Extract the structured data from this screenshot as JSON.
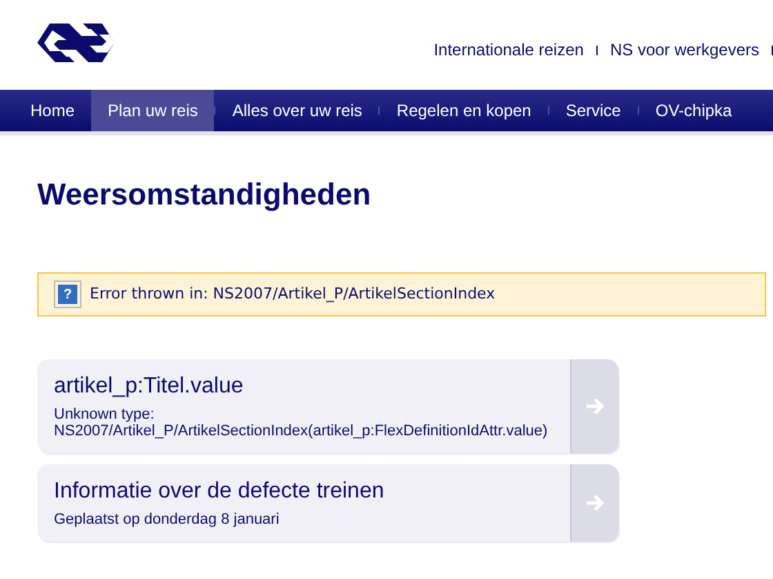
{
  "top_links": [
    "Internationale reizen",
    "NS voor werkgevers"
  ],
  "nav": [
    {
      "label": "Home",
      "selected": false
    },
    {
      "label": "Plan uw reis",
      "selected": true
    },
    {
      "label": "Alles over uw reis",
      "selected": false
    },
    {
      "label": "Regelen en kopen",
      "selected": false
    },
    {
      "label": "Service",
      "selected": false
    },
    {
      "label": "OV-chipka",
      "selected": false
    }
  ],
  "title": "Weersomstandigheden",
  "error": {
    "icon": "?",
    "text": "Error thrown in: NS2007/Artikel_P/ArtikelSectionIndex"
  },
  "cards": [
    {
      "title": "artikel_p:Titel.value",
      "subtitle": "Unknown type: NS2007/Artikel_P/ArtikelSectionIndex(artikel_p:FlexDefinitionIdAttr.value)"
    },
    {
      "title": "Informatie over de defecte treinen",
      "subtitle": "Geplaatst op donderdag 8 januari"
    }
  ]
}
